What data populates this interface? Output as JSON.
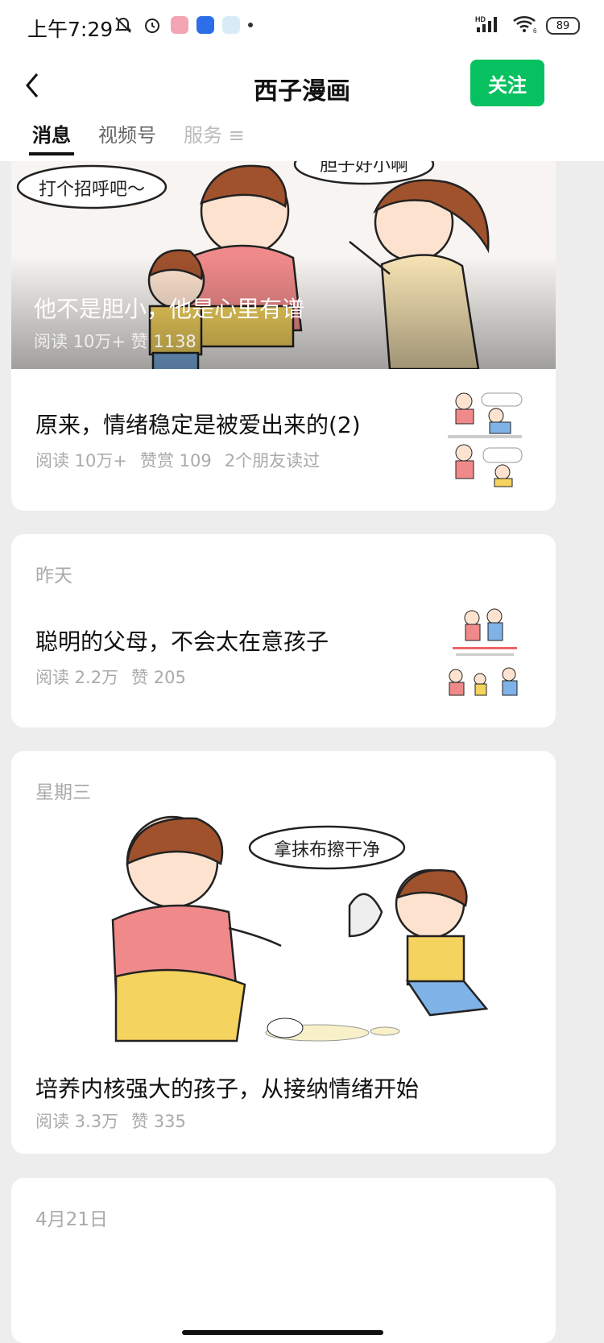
{
  "status_bar": {
    "time": "上午7:29",
    "network_label": "HD",
    "wifi_label": "6",
    "battery": "89"
  },
  "header": {
    "title": "西子漫画",
    "follow_label": "关注"
  },
  "tabs": [
    {
      "label": "消息"
    },
    {
      "label": "视频号"
    },
    {
      "label": "服务"
    }
  ],
  "articles": {
    "hero": {
      "title": "他不是胆小，他是心里有谱",
      "meta": "阅读 10万+  赞 1138",
      "bubbles": [
        "打个招呼吧～",
        "胆子好小啊"
      ]
    },
    "item1": {
      "title": "原来，情绪稳定是被爱出来的(2)",
      "reads": "阅读 10万+",
      "likes": "赞赏 109",
      "friends": "2个朋友读过"
    },
    "item2": {
      "date": "昨天",
      "title": "聪明的父母，不会太在意孩子",
      "reads": "阅读 2.2万",
      "likes": "赞 205"
    },
    "item3": {
      "date": "星期三",
      "title": "培养内核强大的孩子，从接纳情绪开始",
      "reads": "阅读 3.3万",
      "likes": "赞 335",
      "bubble": "拿抹布擦干净"
    },
    "item4": {
      "date": "4月21日"
    }
  },
  "colors": {
    "accent": "#07c160",
    "background": "#ededed",
    "meta_text": "#aaaaaa"
  }
}
